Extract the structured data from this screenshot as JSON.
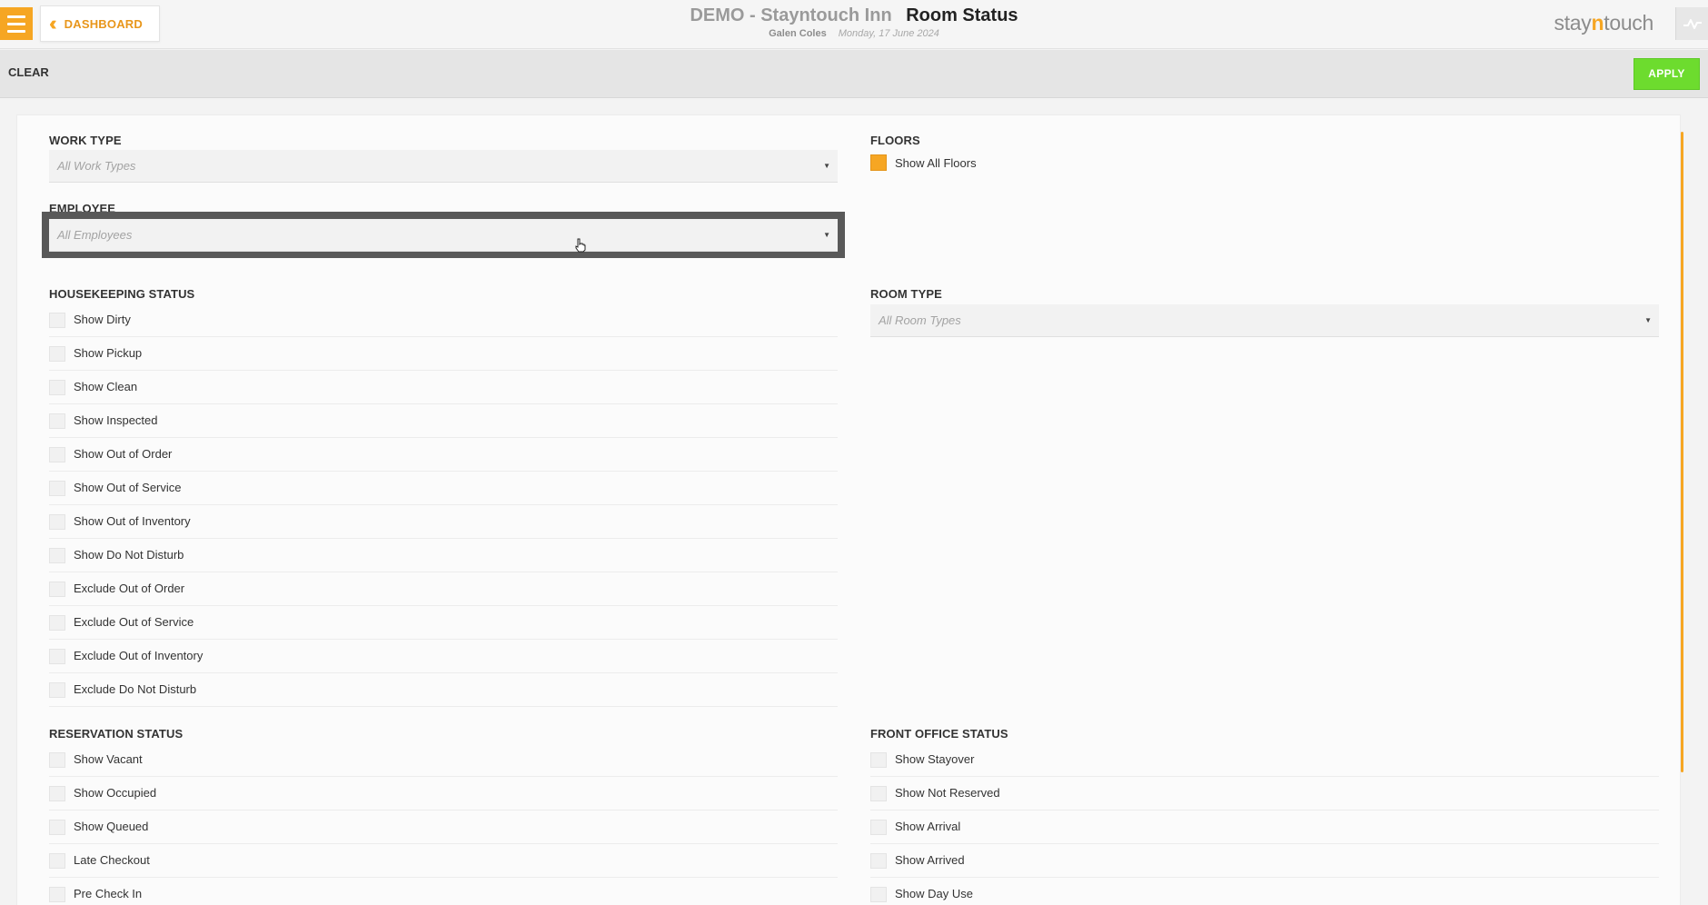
{
  "header": {
    "dashboard_label": "DASHBOARD",
    "hotel_name": "DEMO - Stayntouch Inn",
    "page_title": "Room Status",
    "user_name": "Galen Coles",
    "date": "Monday, 17 June 2024",
    "logo": {
      "prefix": "stay",
      "accent": "n",
      "suffix": "touch"
    }
  },
  "actionbar": {
    "clear_label": "CLEAR",
    "apply_label": "APPLY"
  },
  "work_type": {
    "label": "WORK TYPE",
    "placeholder": "All Work Types"
  },
  "employee": {
    "label": "EMPLOYEE",
    "placeholder": "All Employees"
  },
  "floors": {
    "label": "FLOORS",
    "show_all_label": "Show All Floors",
    "show_all_checked": true
  },
  "room_type": {
    "label": "ROOM TYPE",
    "placeholder": "All Room Types"
  },
  "housekeeping": {
    "label": "HOUSEKEEPING STATUS",
    "items": [
      "Show Dirty",
      "Show Pickup",
      "Show Clean",
      "Show Inspected",
      "Show Out of Order",
      "Show Out of Service",
      "Show Out of Inventory",
      "Show Do Not Disturb",
      "Exclude Out of Order",
      "Exclude Out of Service",
      "Exclude Out of Inventory",
      "Exclude Do Not Disturb"
    ]
  },
  "reservation": {
    "label": "RESERVATION STATUS",
    "items": [
      "Show Vacant",
      "Show Occupied",
      "Show Queued",
      "Late Checkout",
      "Pre Check In"
    ]
  },
  "front_office": {
    "label": "FRONT OFFICE STATUS",
    "items": [
      "Show Stayover",
      "Show Not Reserved",
      "Show Arrival",
      "Show Arrived",
      "Show Day Use"
    ]
  },
  "colors": {
    "accent": "#f6a623",
    "apply": "#6ddc2e"
  },
  "icons": {
    "menu": "hamburger-icon",
    "back": "double-chevron-left-icon",
    "pulse": "pulse-icon",
    "select_arrow": "caret-down-icon"
  }
}
